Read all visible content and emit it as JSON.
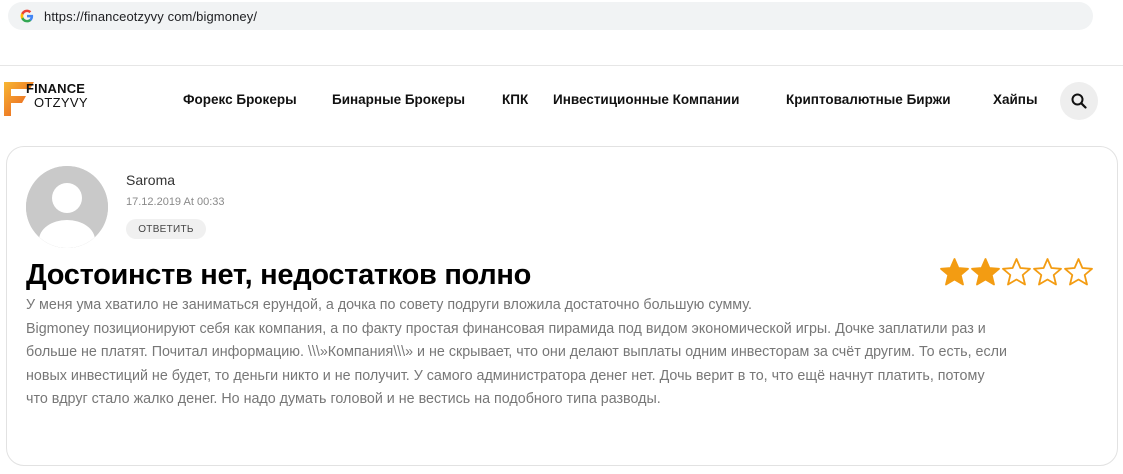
{
  "browser": {
    "url": "https://financeotzyvy com/bigmoney/"
  },
  "logo": {
    "line1": "FINANCE",
    "line2": "OTZYVY"
  },
  "nav": {
    "items": [
      {
        "label": "Форекс Брокеры"
      },
      {
        "label": "Бинарные Брокеры"
      },
      {
        "label": "КПК"
      },
      {
        "label": "Инвестиционные Компании"
      },
      {
        "label": "Криптовалютные Биржи"
      },
      {
        "label": "Хайпы"
      }
    ],
    "search_icon": "search-icon"
  },
  "review": {
    "author": "Saroma",
    "date": "17.12.2019 At 00:33",
    "reply_label": "ОТВЕТИТЬ",
    "title": "Достоинств нет, недостатков полно",
    "rating": 2,
    "rating_max": 5,
    "star_color": "#f39c12",
    "body_lines": [
      "У меня ума хватило не заниматься ерундой, а дочка по совету подруги вложила достаточно большую сумму.",
      "Bigmoney позиционируют себя как компания, а по факту простая финансовая пирамида под видом экономической игры. Дочке заплатили раз и",
      "больше не платят. Почитал информацию. \\\\\\»Компания\\\\\\» и не скрывает, что они делают выплаты одним инвесторам за счёт другим. То есть, если",
      "новых инвестиций не будет, то деньги никто и не получит. У самого администратора денег нет. Дочь верит в то, что ещё начнут платить, потому",
      "что вдруг стало жалко денег. Но надо думать головой и не вестись на подобного типа разводы."
    ]
  },
  "colors": {
    "accent": "#f39c12",
    "text_body": "#777777",
    "card_border": "#e2e2e2"
  }
}
